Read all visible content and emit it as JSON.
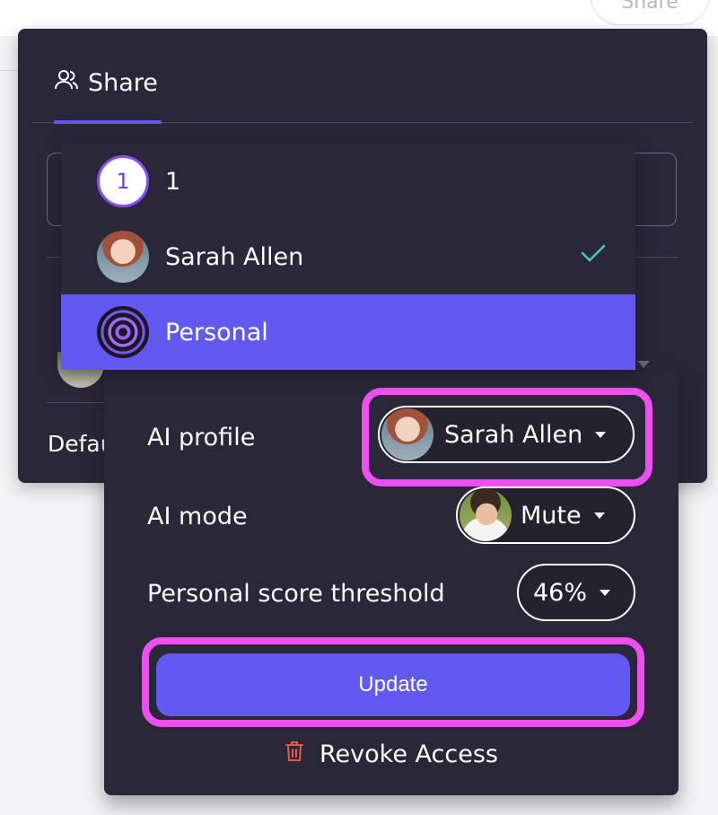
{
  "top_bar": {
    "share_button_label": "Share"
  },
  "share_panel": {
    "tab_label": "Share",
    "default_label_partial": "Defau"
  },
  "dropdown": {
    "items": [
      {
        "avatar_text": "1",
        "label": "1",
        "selected": false,
        "checked": false
      },
      {
        "label": "Sarah Allen",
        "selected": false,
        "checked": true
      },
      {
        "label": "Personal",
        "selected": true,
        "checked": false
      }
    ]
  },
  "settings": {
    "ai_profile_label": "AI profile",
    "ai_profile_value": "Sarah Allen",
    "ai_mode_label": "AI mode",
    "ai_mode_value": "Mute",
    "threshold_label": "Personal score threshold",
    "threshold_value": "46%",
    "update_label": "Update",
    "revoke_label": "Revoke Access"
  },
  "colors": {
    "panel_bg": "#2a2738",
    "accent": "#6258f2",
    "highlight": "#ef4ff0",
    "check": "#4fc9b5",
    "revoke_icon": "#e8564f"
  },
  "icons": {
    "share_tab": "users-icon",
    "check": "check-icon",
    "caret": "caret-down-icon",
    "revoke": "trash-icon"
  }
}
